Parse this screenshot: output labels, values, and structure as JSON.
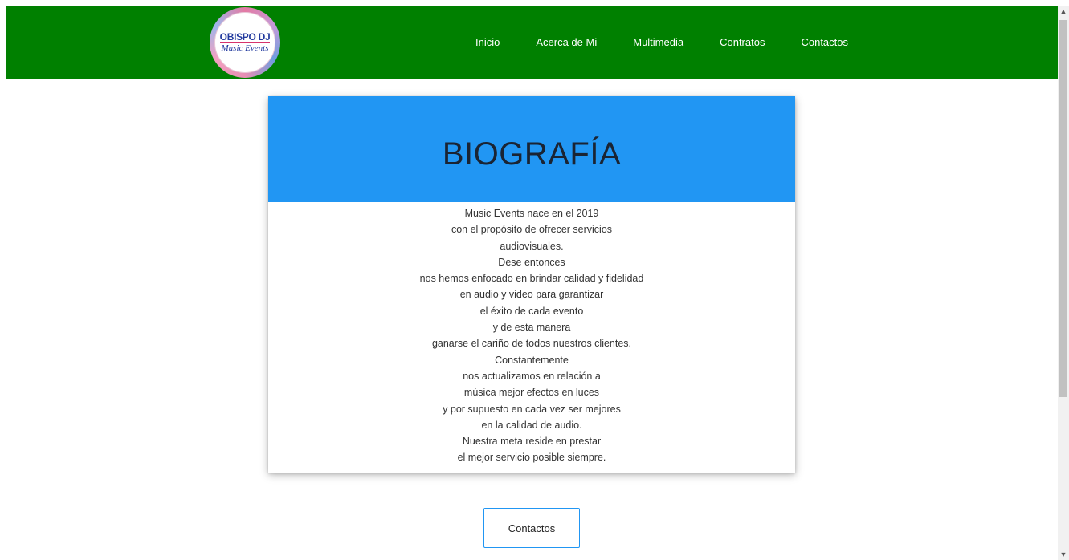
{
  "brand": {
    "logo_top": "OBISPO DJ",
    "logo_bottom": "Music Events",
    "color": "#008000"
  },
  "nav": {
    "items": [
      {
        "label": "Inicio"
      },
      {
        "label": "Acerca de Mi"
      },
      {
        "label": "Multimedia"
      },
      {
        "label": "Contratos"
      },
      {
        "label": "Contactos"
      }
    ]
  },
  "bio": {
    "title": "BIOGRAFÍA",
    "header_color": "#2196f3",
    "lines": [
      "Music Events nace en el 2019",
      "con el propósito de ofrecer servicios",
      "audiovisuales.",
      "Dese entonces",
      "nos hemos enfocado en brindar calidad y fidelidad",
      "en audio y video para garantizar",
      "el éxito de cada evento",
      "y de esta manera",
      "ganarse el cariño de todos nuestros clientes.",
      "Constantemente",
      "nos actualizamos en relación a",
      "música mejor efectos en luces",
      "y por supuesto en cada vez ser mejores",
      "en la calidad de audio.",
      "Nuestra meta reside en prestar",
      "el mejor servicio posible siempre."
    ]
  },
  "actions": {
    "contact_label": "Contactos"
  },
  "scrollbar": {
    "up_icon": "chevron-up-icon",
    "down_icon": "chevron-down-icon"
  }
}
